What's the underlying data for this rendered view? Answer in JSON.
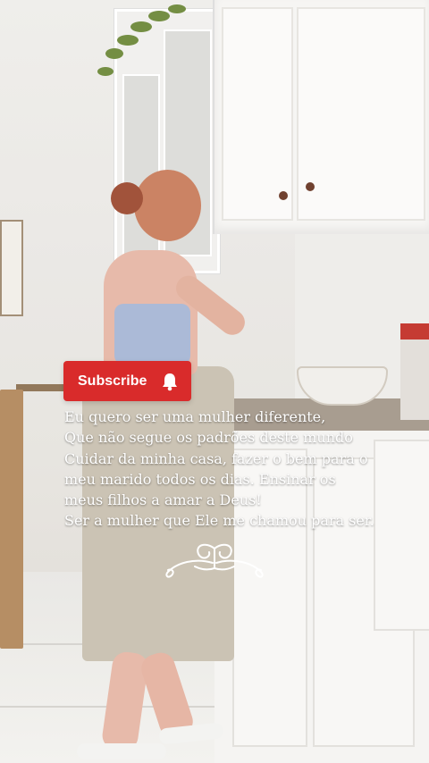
{
  "subscribe": {
    "label": "Subscribe",
    "icon": "bell-icon",
    "color": "#d92b2b"
  },
  "caption": {
    "lines": [
      "Eu quero ser uma mulher diferente,",
      "Que não segue os padrões deste mundo",
      "Cuidar da minha casa, fazer o bem para o",
      "meu marido todos os dias. Ensinar os",
      "meus filhos a amar a Deus!",
      "Ser a mulher que Ele me chamou para ser."
    ]
  },
  "decorations": {
    "flourish": "flourish-ornament-icon"
  }
}
